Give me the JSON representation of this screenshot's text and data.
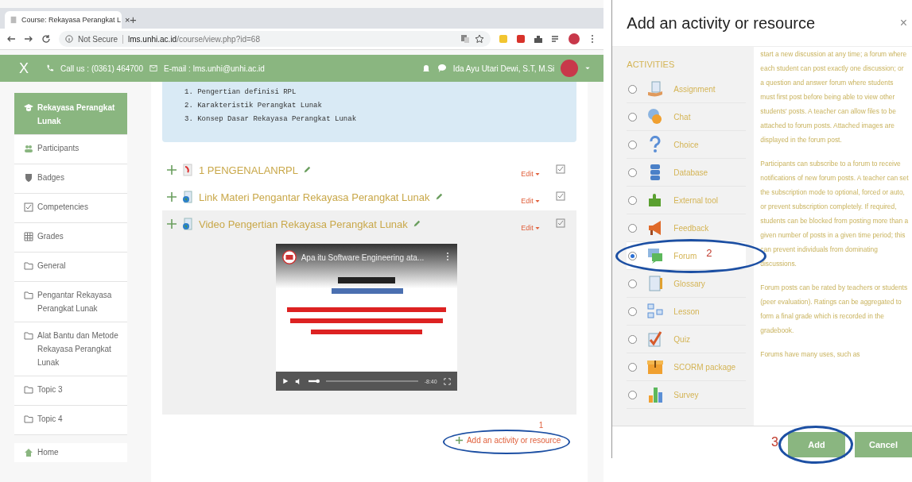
{
  "browser": {
    "tab_title": "Course: Rekayasa Perangkat L",
    "tab_close": "×",
    "new_tab": "+",
    "security": "Not Secure",
    "url_host": "lms.unhi.ac.id",
    "url_path": "/course/view.php?id=68"
  },
  "header": {
    "close": "X",
    "call": "Call us : (0361) 464700",
    "email": "E-mail : lms.unhi@unhi.ac.id",
    "user": "Ida Ayu Utari Dewi, S.T, M.Si"
  },
  "sidebar": {
    "items": [
      {
        "label": "Rekayasa Perangkat Lunak",
        "kind": "course",
        "selected": true
      },
      {
        "label": "Participants",
        "kind": "participants",
        "selected": false
      },
      {
        "label": "Badges",
        "kind": "badge",
        "selected": false
      },
      {
        "label": "Competencies",
        "kind": "check",
        "selected": false
      },
      {
        "label": "Grades",
        "kind": "grid",
        "selected": false
      },
      {
        "label": "General",
        "kind": "folder",
        "selected": false
      },
      {
        "label": "Pengantar Rekayasa Perangkat Lunak",
        "kind": "folder",
        "selected": false
      },
      {
        "label": "Alat Bantu dan Metode Rekayasa Perangkat Lunak",
        "kind": "folder",
        "selected": false
      },
      {
        "label": "Topic 3",
        "kind": "folder",
        "selected": false
      },
      {
        "label": "Topic 4",
        "kind": "folder",
        "selected": false
      }
    ],
    "home": "Home"
  },
  "summary": {
    "items": [
      "1. Pengertian definisi RPL",
      "2. Karakteristik Perangkat Lunak",
      "3. Konsep Dasar Rekayasa Perangkat Lunak"
    ]
  },
  "activities": [
    {
      "title": "1 PENGENALANRPL",
      "kind": "pdf",
      "edit": "Edit",
      "highlighted": false
    },
    {
      "title": "Link Materi Pengantar Rekayasa Perangkat Lunak",
      "kind": "url",
      "edit": "Edit",
      "highlighted": false
    },
    {
      "title": "Video Pengertian Rekayasa Perangkat Lunak",
      "kind": "url",
      "edit": "Edit",
      "highlighted": true
    }
  ],
  "video": {
    "title": "Apa itu Software Engineering ata...",
    "time": "-8:40"
  },
  "add_link": {
    "label": "Add an activity or resource",
    "step": "1"
  },
  "modal": {
    "title": "Add an activity or resource",
    "close": "×",
    "section": "ACTIVITIES",
    "options": [
      {
        "label": "Assignment",
        "kind": "assignment",
        "selected": false
      },
      {
        "label": "Chat",
        "kind": "chat",
        "selected": false
      },
      {
        "label": "Choice",
        "kind": "choice",
        "selected": false
      },
      {
        "label": "Database",
        "kind": "database",
        "selected": false
      },
      {
        "label": "External tool",
        "kind": "puzzle",
        "selected": false
      },
      {
        "label": "Feedback",
        "kind": "megaphone",
        "selected": false
      },
      {
        "label": "Forum",
        "kind": "forum",
        "selected": true,
        "step": "2"
      },
      {
        "label": "Glossary",
        "kind": "glossary",
        "selected": false
      },
      {
        "label": "Lesson",
        "kind": "lesson",
        "selected": false
      },
      {
        "label": "Quiz",
        "kind": "quiz",
        "selected": false
      },
      {
        "label": "SCORM package",
        "kind": "scorm",
        "selected": false
      },
      {
        "label": "Survey",
        "kind": "survey",
        "selected": false
      }
    ],
    "description": [
      "start a new discussion at any time; a forum where each student can post exactly one discussion; or a question and answer forum where students must first post before being able to view other students' posts. A teacher can allow files to be attached to forum posts. Attached images are displayed in the forum post.",
      "Participants can subscribe to a forum to receive notifications of new forum posts. A teacher can set the subscription mode to optional, forced or auto, or prevent subscription completely. If required, students can be blocked from posting more than a given number of posts in a given time period; this can prevent individuals from dominating discussions.",
      "Forum posts can be rated by teachers or students (peer evaluation). Ratings can be aggregated to form a final grade which is recorded in the gradebook.",
      "Forums have many uses, such as"
    ],
    "add_step": "3",
    "add": "Add",
    "cancel": "Cancel"
  }
}
